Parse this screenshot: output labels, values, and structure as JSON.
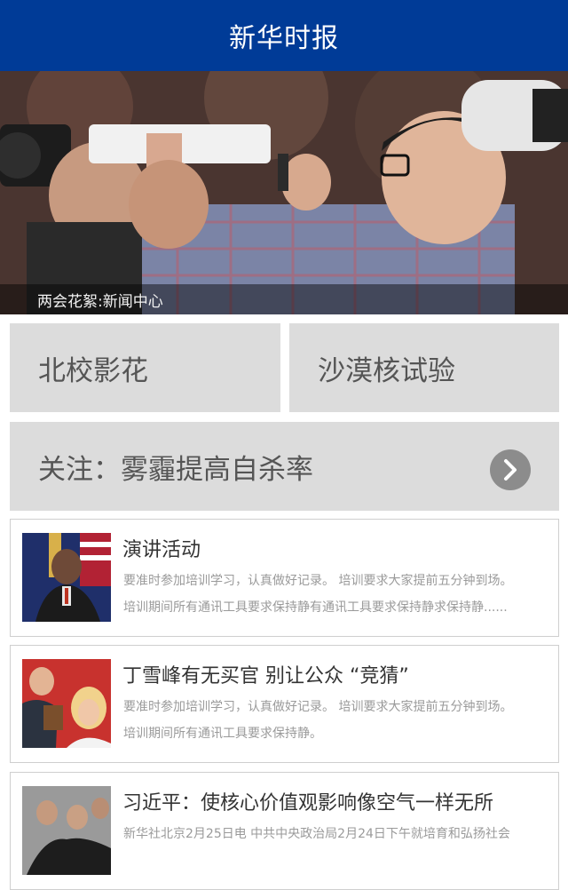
{
  "header": {
    "title": "新华时报"
  },
  "hero": {
    "caption": "两会花絮:新闻中心"
  },
  "tiles": [
    {
      "label": "北校影花"
    },
    {
      "label": "沙漠核试验"
    }
  ],
  "featured": {
    "label": "关注：雾霾提高自杀率",
    "icon": "chevron-right-icon"
  },
  "news": [
    {
      "title": "演讲活动",
      "line1": "要准时参加培训学习，认真做好记录。   培训要求大家提前五分钟到场。",
      "line2": "培训期间所有通讯工具要求保持静有通讯工具要求保持静求保持静......"
    },
    {
      "title": "丁雪峰有无买官 别让公众 “竞猜”",
      "line1": "要准时参加培训学习，认真做好记录。   培训要求大家提前五分钟到场。",
      "line2": "培训期间所有通讯工具要求保持静。"
    },
    {
      "title": "习近平：使核心价值观影响像空气一样无所",
      "line1": "新华社北京2月25日电   中共中央政治局2月24日下午就培育和弘扬社会"
    }
  ],
  "colors": {
    "header_bg": "#003b97",
    "tile_bg": "#dcdcdc"
  }
}
